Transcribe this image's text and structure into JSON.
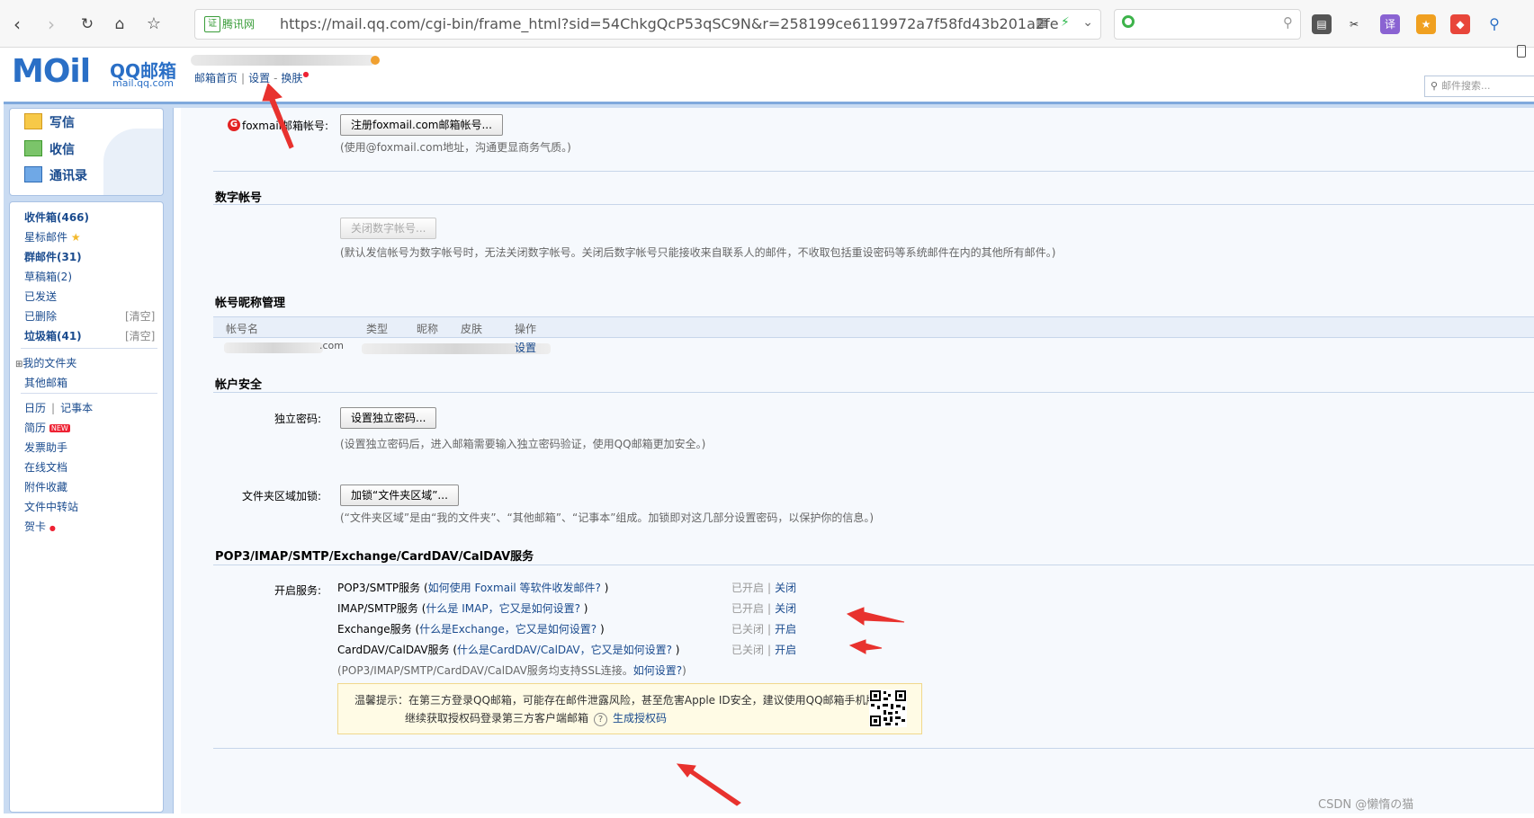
{
  "browser": {
    "cert_label": "腾讯网",
    "url": "https://mail.qq.com/cgi-bin/frame_html?sid=54ChkgQcP53qSC9N&r=258199ce6119972a7f58fd43b201a2fe",
    "ext_translate": "译",
    "nav_icons": [
      "back-icon",
      "forward-icon",
      "reload-icon",
      "home-icon",
      "star-icon"
    ]
  },
  "header": {
    "logo_mail": "MOil",
    "logo_title": "QQ邮箱",
    "logo_domain": "mail.qq.com",
    "links": [
      "邮箱首页",
      "设置",
      "换肤"
    ],
    "search_placeholder": "邮件搜索..."
  },
  "sidebar": {
    "compose": "写信",
    "receive": "收信",
    "contacts": "通讯录",
    "folders": [
      {
        "label": "收件箱(466)",
        "bold": true
      },
      {
        "label": "星标邮件",
        "bold": false
      },
      {
        "label": "群邮件(31)",
        "bold": true
      },
      {
        "label": "草稿箱(2)",
        "bold": false
      },
      {
        "label": "已发送",
        "bold": false
      },
      {
        "label": "已删除",
        "bold": false,
        "action": "[清空]"
      },
      {
        "label": "垃圾箱(41)",
        "bold": true,
        "action": "[清空]"
      }
    ],
    "my_folders": "我的文件夹",
    "other_mail": "其他邮箱",
    "tools": {
      "calendar": "日历",
      "notes": "记事本",
      "resume": "简历",
      "new_badge": "NEW",
      "invoice": "发票助手",
      "docs": "在线文档",
      "attachments": "附件收藏",
      "transfer": "文件中转站",
      "card": "贺卡"
    }
  },
  "content": {
    "foxmail": {
      "label": "foxmail邮箱帐号:",
      "button": "注册foxmail.com邮箱帐号...",
      "hint": "(使用@foxmail.com地址，沟通更显商务气质。)"
    },
    "digital": {
      "title": "数字帐号",
      "button": "关闭数字帐号...",
      "hint": "(默认发信帐号为数字帐号时，无法关闭数字帐号。关闭后数字帐号只能接收来自联系人的邮件，不收取包括重设密码等系统邮件在内的其他所有邮件。)"
    },
    "nickname": {
      "title": "帐号昵称管理",
      "columns": [
        "帐号名",
        "类型",
        "昵称",
        "皮肤",
        "操作"
      ],
      "row_suffix": ".com",
      "row_action": "设置"
    },
    "security": {
      "title": "帐户安全",
      "pwd_label": "独立密码:",
      "pwd_button": "设置独立密码...",
      "pwd_hint": "(设置独立密码后，进入邮箱需要输入独立密码验证，使用QQ邮箱更加安全。)",
      "lock_label": "文件夹区域加锁:",
      "lock_button": "加锁“文件夹区域”...",
      "lock_hint": "(“文件夹区域”是由“我的文件夹”、“其他邮箱”、“记事本”组成。加锁即对这几部分设置密码，以保护你的信息。)"
    },
    "services": {
      "title": "POP3/IMAP/SMTP/Exchange/CardDAV/CalDAV服务",
      "label": "开启服务:",
      "items": [
        {
          "name": "POP3/SMTP服务",
          "help": "如何使用 Foxmail 等软件收发邮件?",
          "status": "已开启",
          "action": "关闭"
        },
        {
          "name": "IMAP/SMTP服务",
          "help": "什么是 IMAP，它又是如何设置?",
          "status": "已开启",
          "action": "关闭"
        },
        {
          "name": "Exchange服务",
          "help": "什么是Exchange，它又是如何设置?",
          "status": "已关闭",
          "action": "开启"
        },
        {
          "name": "CardDAV/CalDAV服务",
          "help": "什么是CardDAV/CalDAV，它又是如何设置?",
          "status": "已关闭",
          "action": "开启"
        }
      ],
      "ssl_note": "(POP3/IMAP/SMTP/CardDAV/CalDAV服务均支持SSL连接。",
      "ssl_link": "如何设置?",
      "ssl_close": ")",
      "tip_line1": "温馨提示：在第三方登录QQ邮箱，可能存在邮件泄露风险，甚至危害Apple ID安全，建议使用QQ邮箱手机版登录。",
      "tip_line2": "继续获取授权码登录第三方客户端邮箱",
      "tip_help": "?",
      "tip_link": "生成授权码"
    }
  },
  "watermark": "CSDN @懒惰の猫",
  "colors": {
    "accent": "#1a4b8e",
    "frame": "#c9dbf2",
    "arrow": "#e8322e"
  }
}
